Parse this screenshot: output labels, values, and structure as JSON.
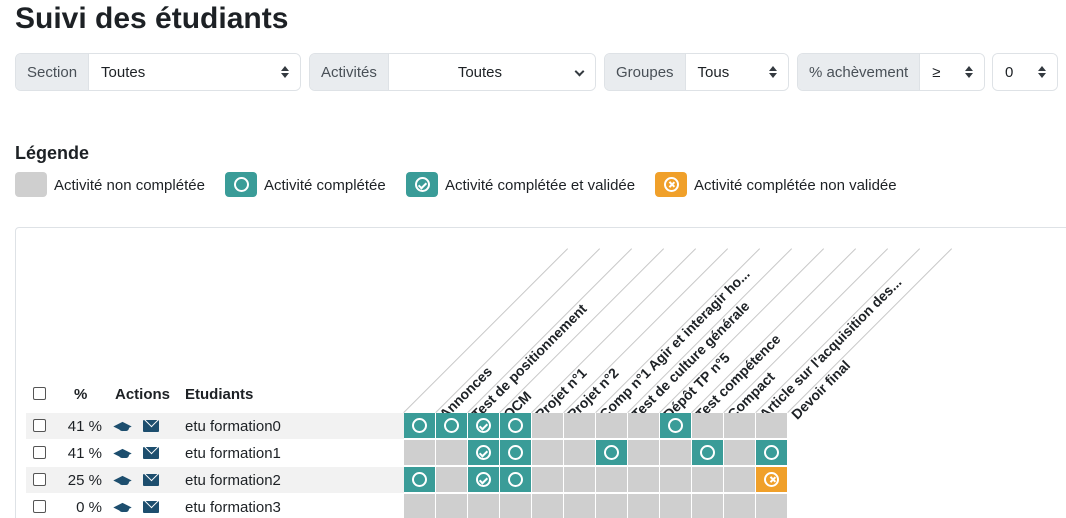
{
  "page_title": "Suivi des étudiants",
  "filters": {
    "section": {
      "label": "Section",
      "value": "Toutes"
    },
    "activites": {
      "label": "Activités",
      "value": "Toutes"
    },
    "groupes": {
      "label": "Groupes",
      "value": "Tous"
    },
    "achevement": {
      "label": "% achèvement",
      "operator": "≥",
      "value": "0"
    }
  },
  "legend": {
    "title": "Légende",
    "items": [
      {
        "label": "Activité non complétée",
        "state": "none"
      },
      {
        "label": "Activité complétée",
        "state": "done"
      },
      {
        "label": "Activité complétée et validée",
        "state": "valid"
      },
      {
        "label": "Activité complétée non validée",
        "state": "fail"
      }
    ]
  },
  "table": {
    "headers": {
      "percent": "%",
      "actions": "Actions",
      "students": "Etudiants"
    },
    "activities": [
      "Annonces",
      "Test de positionnement",
      "QCM",
      "Projet n°1",
      "Projet n°2",
      "Comp n°1 Agir et interagir ho...",
      "Test de culture générale",
      "Dépôt TP n°5",
      "Test compétence",
      "Compact",
      "Article sur l'acquisition des...",
      "Devoir final"
    ],
    "rows": [
      {
        "percent": "41 %",
        "name": "etu formation0",
        "cells": [
          "done",
          "done",
          "valid",
          "done",
          "none",
          "none",
          "none",
          "none",
          "done",
          "none",
          "none",
          "none"
        ]
      },
      {
        "percent": "41 %",
        "name": "etu formation1",
        "cells": [
          "none",
          "none",
          "valid",
          "done",
          "none",
          "none",
          "done",
          "none",
          "none",
          "done",
          "none",
          "done"
        ]
      },
      {
        "percent": "25 %",
        "name": "etu formation2",
        "cells": [
          "done",
          "none",
          "valid",
          "done",
          "none",
          "none",
          "none",
          "none",
          "none",
          "none",
          "none",
          "fail"
        ]
      },
      {
        "percent": "0 %",
        "name": "etu formation3",
        "cells": [
          "none",
          "none",
          "none",
          "none",
          "none",
          "none",
          "none",
          "none",
          "none",
          "none",
          "none",
          "none"
        ]
      }
    ]
  }
}
